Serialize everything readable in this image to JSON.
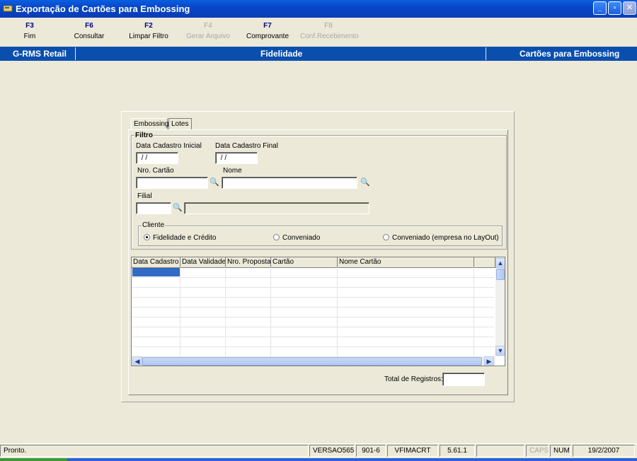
{
  "window": {
    "title": "Exportação de Cartões para Embossing",
    "minimize_glyph": "_",
    "maximize_glyph": "▫",
    "close_glyph": "✕"
  },
  "fkeys": [
    {
      "key": "F3",
      "label": "Fim",
      "enabled": true
    },
    {
      "key": "F6",
      "label": "Consultar",
      "enabled": true
    },
    {
      "key": "F2",
      "label": "Limpar Filtro",
      "enabled": true
    },
    {
      "key": "F4",
      "label": "Gerar Arquivo",
      "enabled": false
    },
    {
      "key": "F7",
      "label": "Comprovante",
      "enabled": true
    },
    {
      "key": "F8",
      "label": "Conf.Recebimento",
      "enabled": false
    }
  ],
  "infobar": {
    "left": "G-RMS Retail",
    "center": "Fidelidade",
    "right": "Cartões para Embossing",
    "color": "#0A4FAE"
  },
  "tabs": [
    {
      "label": "Embossing",
      "active": true
    },
    {
      "label": "Lotes",
      "active": false
    }
  ],
  "filtro": {
    "legend": "Filtro",
    "data_inicial_label": "Data Cadastro Inicial",
    "data_inicial_value": " / /",
    "data_final_label": "Data Cadastro Final",
    "data_final_value": " / /",
    "nro_cartao_label": "Nro. Cartão",
    "nro_cartao_value": "",
    "nome_label": "Nome",
    "nome_value": "",
    "filial_label": "Filial",
    "filial_value": "",
    "filial_desc_value": "",
    "search_glyph": "🔍"
  },
  "cliente": {
    "legend": "Cliente",
    "options": [
      {
        "label": "Fidelidade e Crédito",
        "selected": true
      },
      {
        "label": "Conveniado",
        "selected": false
      },
      {
        "label": "Conveniado (empresa no LayOut)",
        "selected": false
      }
    ]
  },
  "grid": {
    "columns": [
      "Data Cadastro",
      "Data Validade",
      "Nro. Proposta",
      "Cartão",
      "Nome Cartão"
    ],
    "rows": [],
    "selection_color": "#316AC5"
  },
  "total": {
    "label": "Total de Registros:",
    "value": ""
  },
  "status": {
    "message": "Pronto.",
    "cells": [
      {
        "text": "VERSAO565",
        "active": true
      },
      {
        "text": "901-6",
        "active": true
      },
      {
        "text": "VFIMACRT",
        "active": true
      },
      {
        "text": "5.61.1",
        "active": true
      },
      {
        "text": "",
        "active": true
      },
      {
        "text": "CAPS",
        "active": false
      },
      {
        "text": "NUM",
        "active": true
      },
      {
        "text": "19/2/2007",
        "active": true
      }
    ]
  }
}
